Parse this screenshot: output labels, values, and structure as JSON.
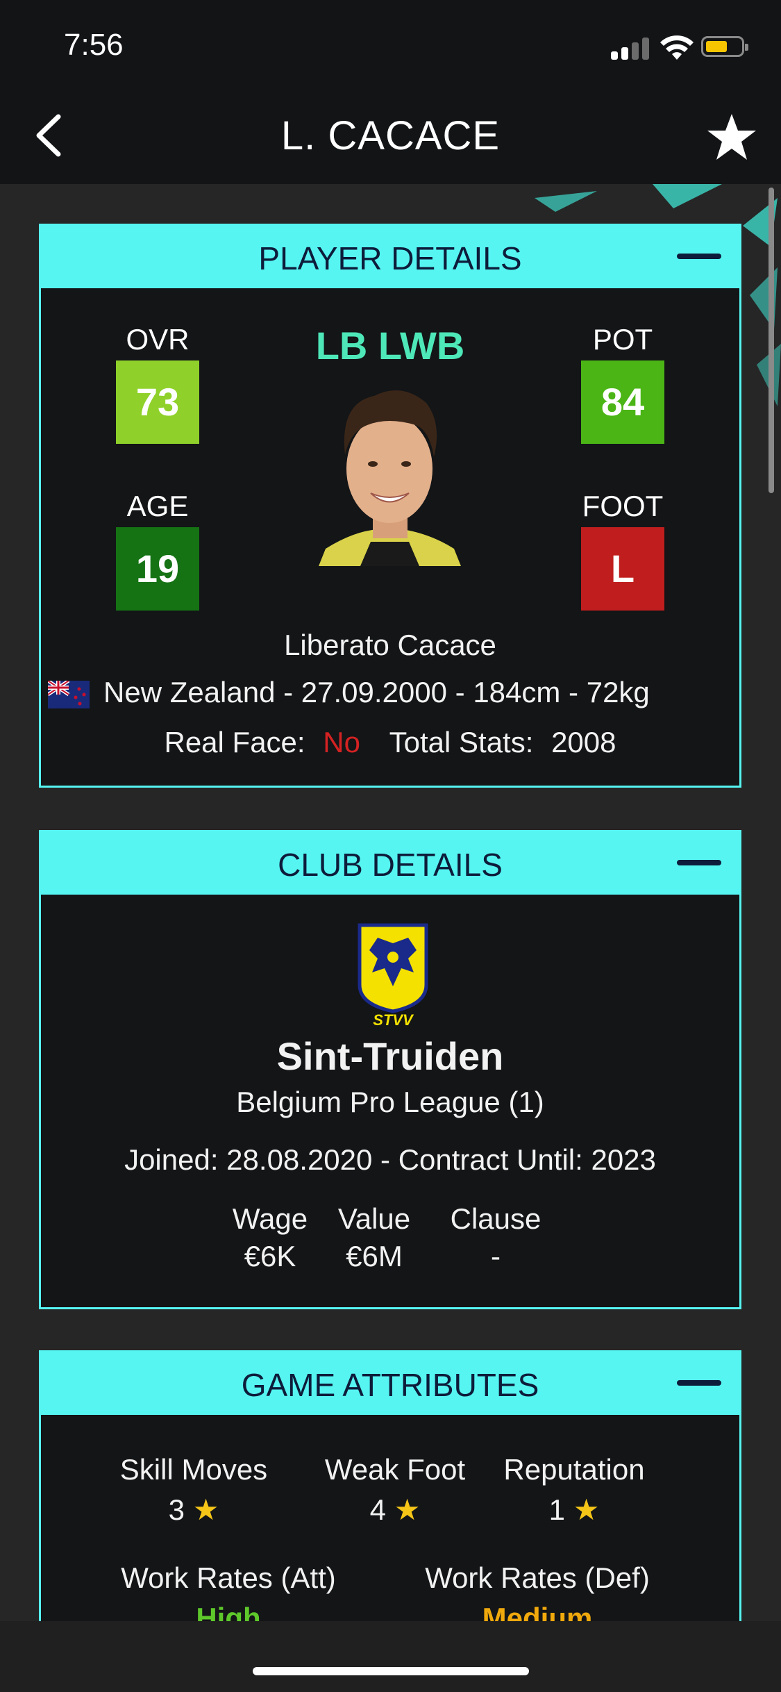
{
  "status": {
    "time": "7:56"
  },
  "nav": {
    "title": "L. CACACE"
  },
  "player": {
    "header": "PLAYER DETAILS",
    "ovr_label": "OVR",
    "ovr_value": "73",
    "pot_label": "POT",
    "pot_value": "84",
    "age_label": "AGE",
    "age_value": "19",
    "foot_label": "FOOT",
    "foot_value": "L",
    "positions": "LB LWB",
    "full_name": "Liberato Cacace",
    "bio": "New Zealand - 27.09.2000 - 184cm - 72kg",
    "real_face_label": "Real Face:",
    "real_face_value": "No",
    "total_stats_label": "Total Stats:",
    "total_stats_value": "2008",
    "colors": {
      "ovr": "#8fd12a",
      "pot": "#4bb516",
      "age": "#157314",
      "foot": "#c01e1e",
      "positions": "#4ee8b8"
    }
  },
  "club": {
    "header": "CLUB DETAILS",
    "logo_text": "STVV",
    "name": "Sint-Truiden",
    "league": "Belgium Pro League (1)",
    "joined": "Joined: 28.08.2020 - Contract Until: 2023",
    "wage_label": "Wage",
    "wage_value": "€6K",
    "value_label": "Value",
    "value_value": "€6M",
    "clause_label": "Clause",
    "clause_value": "-"
  },
  "attributes": {
    "header": "GAME ATTRIBUTES",
    "skill_moves_label": "Skill Moves",
    "skill_moves_value": "3",
    "weak_foot_label": "Weak Foot",
    "weak_foot_value": "4",
    "reputation_label": "Reputation",
    "reputation_value": "1",
    "star_glyph": "★",
    "wr_att_label": "Work Rates (Att)",
    "wr_att_value": "High",
    "wr_def_label": "Work Rates (Def)",
    "wr_def_value": "Medium"
  },
  "icons": [
    "back-chevron-icon",
    "favorite-star-icon",
    "collapse-icon",
    "signal-icon",
    "wifi-icon",
    "battery-icon",
    "new-zealand-flag-icon"
  ],
  "accent": "#56f5f2"
}
